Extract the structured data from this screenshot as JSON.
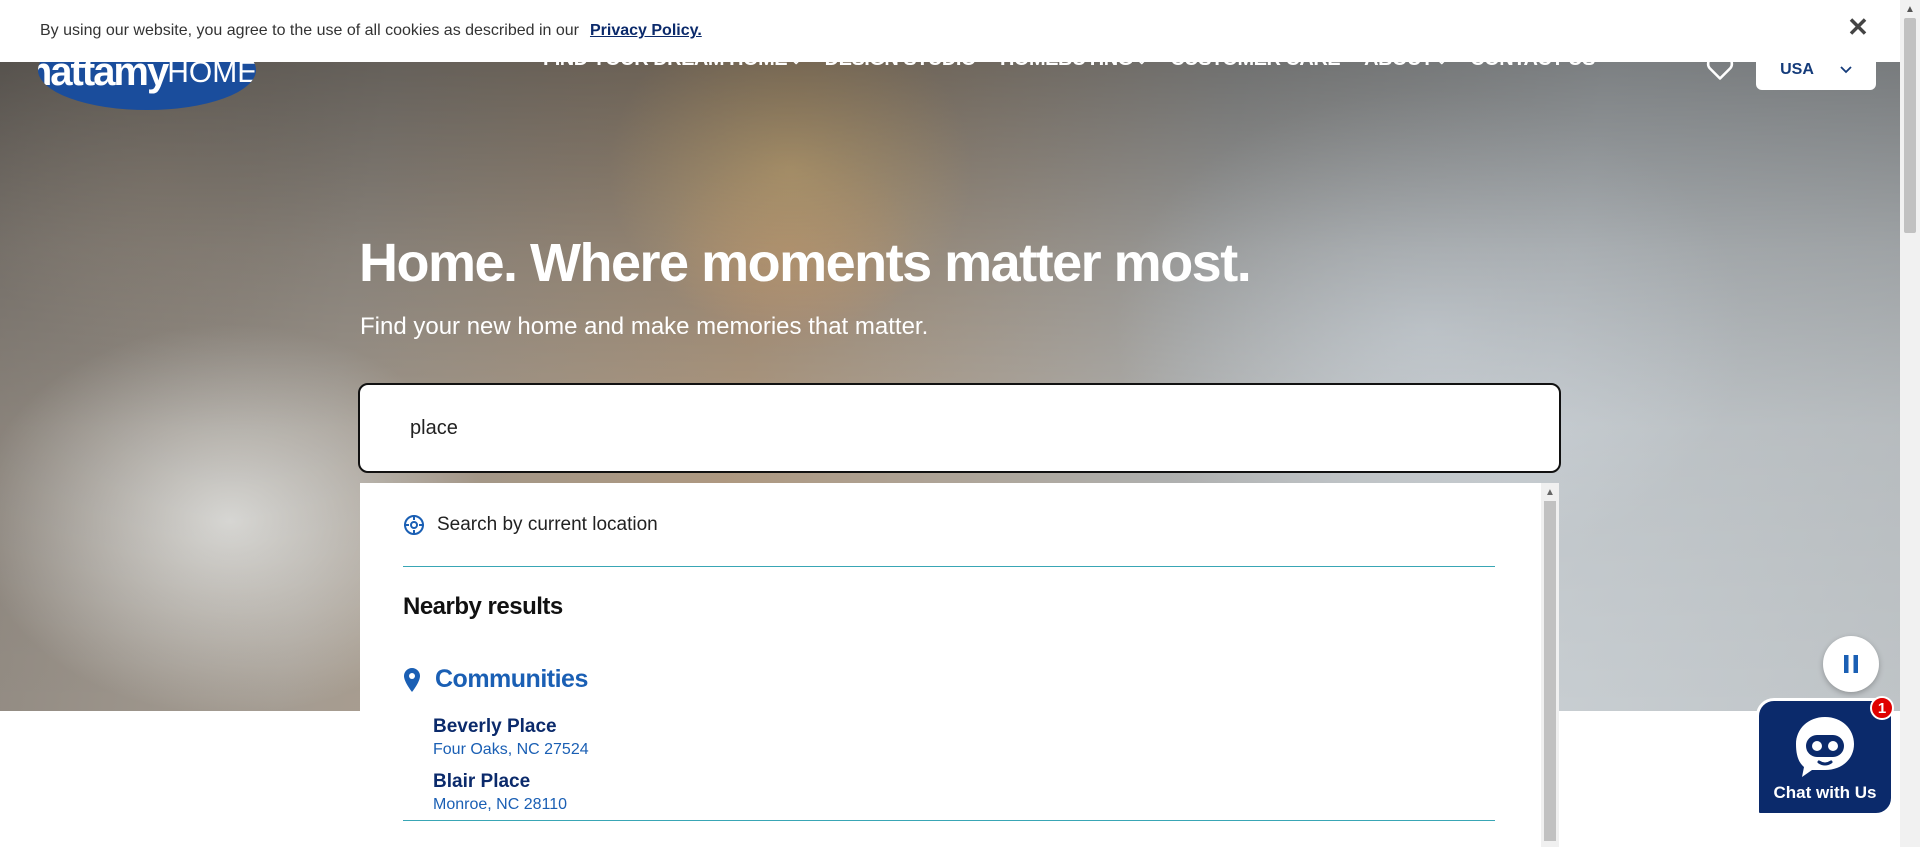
{
  "cookie_bar": {
    "message": "By using our website, you agree to the use of all cookies as described in our",
    "link_label": "Privacy Policy.",
    "close_glyph": "✕"
  },
  "header": {
    "logo": {
      "primary": "mattamy",
      "secondary": "HOMES"
    },
    "nav": [
      {
        "label": "FIND YOUR DREAM HOME",
        "has_dropdown": true
      },
      {
        "label": "DESIGN STUDIO",
        "has_dropdown": false
      },
      {
        "label": "HOMEBUYING",
        "has_dropdown": true
      },
      {
        "label": "CUSTOMER CARE",
        "has_dropdown": false
      },
      {
        "label": "ABOUT",
        "has_dropdown": true
      },
      {
        "label": "CONTACT US",
        "has_dropdown": false
      }
    ],
    "favorites_icon": "heart-icon",
    "country": "USA"
  },
  "hero": {
    "title": "Home. Where moments matter most.",
    "subtitle": "Find your new home and make memories that matter."
  },
  "search": {
    "value": "place"
  },
  "dropdown": {
    "current_location_label": "Search by current location",
    "nearby_title": "Nearby results",
    "communities_label": "Communities",
    "results": [
      {
        "name": "Beverly Place",
        "address": "Four Oaks, NC 27524"
      },
      {
        "name": "Blair Place",
        "address": "Monroe, NC 28110"
      }
    ]
  },
  "chat": {
    "label": "Chat with Us",
    "badge": "1"
  },
  "colors": {
    "brand_blue": "#1a4d9c",
    "navy": "#0b2a6b",
    "link_blue": "#1a5fb4",
    "divider_teal": "#39a6b5",
    "badge_red": "#e00000"
  }
}
